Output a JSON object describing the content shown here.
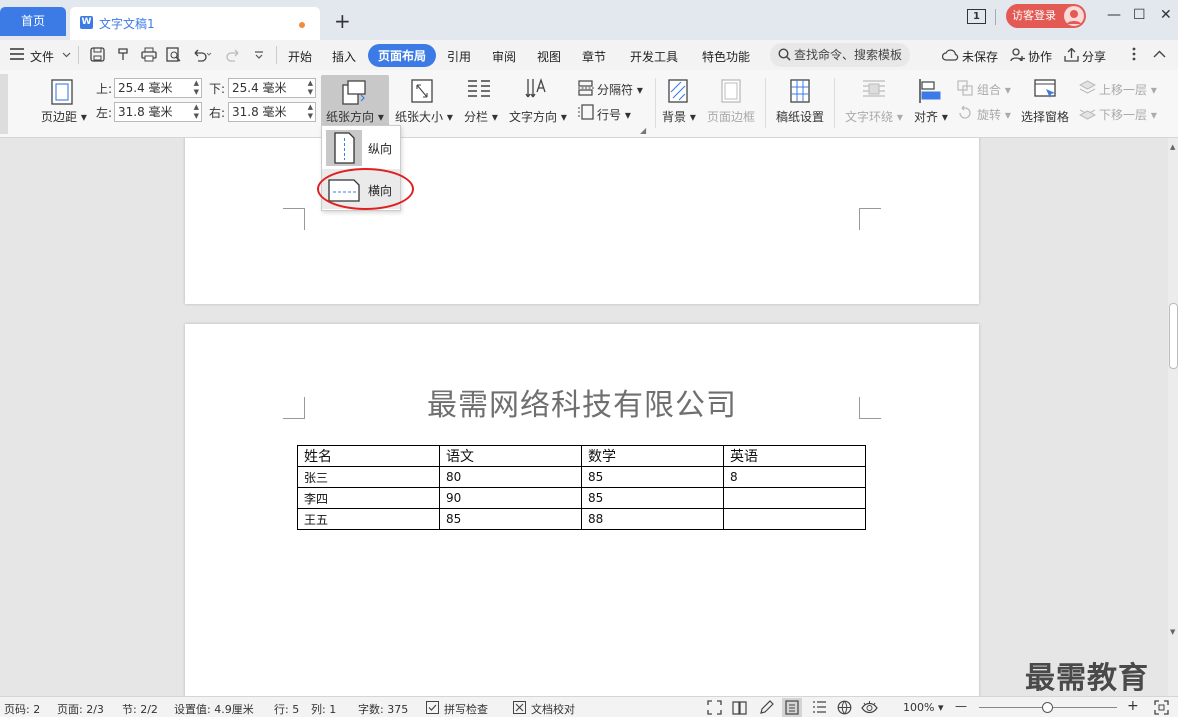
{
  "tabs": {
    "home": "首页",
    "doc_title": "文字文稿1",
    "new_tab": "+"
  },
  "top_right": {
    "badge": "1",
    "login": "访客登录",
    "minimize": "—",
    "maximize": "☐",
    "close": "✕"
  },
  "menu": {
    "file": "文件",
    "items": [
      "开始",
      "插入",
      "页面布局",
      "引用",
      "审阅",
      "视图",
      "章节",
      "开发工具",
      "特色功能"
    ],
    "active": "页面布局",
    "search": "查找命令、搜索模板",
    "unsaved": "未保存",
    "collab": "协作",
    "share": "分享"
  },
  "ribbon": {
    "margin": "页边距",
    "top_label": "上:",
    "top_value": "25.4 毫米",
    "bottom_label": "下:",
    "bottom_value": "25.4 毫米",
    "left_label": "左:",
    "left_value": "31.8 毫米",
    "right_label": "右:",
    "right_value": "31.8 毫米",
    "orientation": "纸张方向",
    "size": "纸张大小",
    "columns": "分栏",
    "text_direction": "文字方向",
    "break": "分隔符",
    "line_number": "行号",
    "background": "背景",
    "page_border": "页面边框",
    "manuscript": "稿纸设置",
    "wrap": "文字环绕",
    "align": "对齐",
    "rotate": "旋转",
    "group": "组合",
    "selection_pane": "选择窗格",
    "bring_forward": "上移一层",
    "send_backward": "下移一层"
  },
  "dropdown": {
    "portrait": "纵向",
    "landscape": "横向"
  },
  "document": {
    "title": "最需网络科技有限公司",
    "table": [
      [
        "姓名",
        "语文",
        "数学",
        "英语"
      ],
      [
        "张三",
        "80",
        "85",
        "8"
      ],
      [
        "李四",
        "90",
        "85",
        ""
      ],
      [
        "王五",
        "85",
        "88",
        ""
      ]
    ]
  },
  "watermark": "最需教育",
  "status": {
    "page_code": "页码: 2",
    "page": "页面: 2/3",
    "section": "节: 2/2",
    "setting": "设置值: 4.9厘米",
    "row": "行: 5",
    "col": "列: 1",
    "words": "字数: 375",
    "spell": "拼写检查",
    "proof": "文档校对",
    "zoom": "100%",
    "zoom_minus": "—",
    "zoom_plus": "+"
  },
  "colors": {
    "accent": "#3c7be6",
    "login": "#e35a55",
    "highlight_ring": "#e02020"
  }
}
